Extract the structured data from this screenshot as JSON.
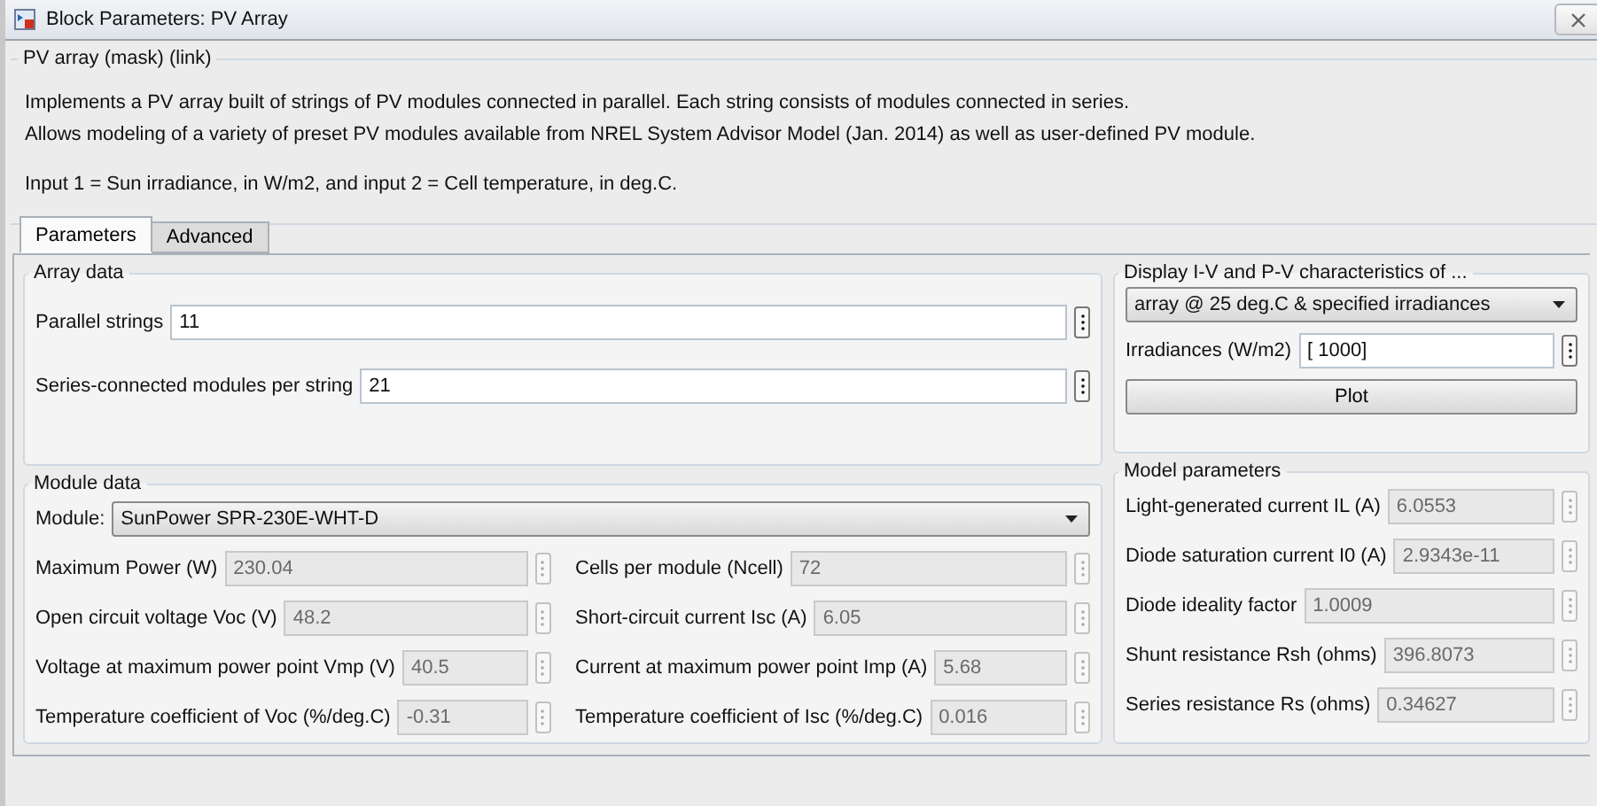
{
  "window": {
    "title": "Block Parameters: PV Array"
  },
  "mask": {
    "title": "PV array (mask) (link)",
    "description": [
      "Implements a PV array built of strings of PV modules connected in parallel. Each string consists of modules connected in series.",
      "Allows modeling of a variety of preset PV modules available from NREL System Advisor Model (Jan. 2014) as well as user-defined PV module."
    ],
    "inputs": "Input 1 = Sun irradiance, in W/m2, and input 2 = Cell temperature, in deg.C."
  },
  "tabs": [
    {
      "label": "Parameters",
      "selected": true
    },
    {
      "label": "Advanced",
      "selected": false
    }
  ],
  "array_data": {
    "title": "Array data",
    "fields": [
      {
        "label": "Parallel strings",
        "value": "11",
        "disabled": false
      },
      {
        "label": "Series-connected modules per string",
        "value": "21",
        "disabled": false
      }
    ]
  },
  "module_data": {
    "title": "Module data",
    "module_label": "Module:",
    "module": "SunPower SPR-230E-WHT-D",
    "fields": [
      {
        "label": "Maximum Power (W)",
        "value": "230.04",
        "disabled": true
      },
      {
        "label": "Cells per module (Ncell)",
        "value": "72",
        "disabled": true
      },
      {
        "label": "Open circuit voltage  Voc (V)",
        "value": "48.2",
        "disabled": true
      },
      {
        "label": "Short-circuit current Isc (A)",
        "value": "6.05",
        "disabled": true
      },
      {
        "label": "Voltage at maximum power point Vmp (V)",
        "value": "40.5",
        "disabled": true
      },
      {
        "label": "Current at maximum power point Imp (A)",
        "value": "5.68",
        "disabled": true
      },
      {
        "label": "Temperature coefficient of Voc (%/deg.C)",
        "value": "-0.31",
        "disabled": true
      },
      {
        "label": "Temperature coefficient of Isc (%/deg.C)",
        "value": "0.016",
        "disabled": true
      }
    ]
  },
  "display": {
    "title": "Display  I-V and P-V characteristics of ...",
    "selection": "array @ 25 deg.C & specified irradiances",
    "field": {
      "label": "Irradiances (W/m2)",
      "value": "[ 1000]",
      "disabled": false
    },
    "button": "Plot"
  },
  "model_parameters": {
    "title": "Model parameters",
    "fields": [
      {
        "label": "Light-generated current IL (A)",
        "value": "6.0553",
        "disabled": true
      },
      {
        "label": "Diode saturation current I0 (A)",
        "value": "2.9343e-11",
        "disabled": true
      },
      {
        "label": "Diode ideality factor",
        "value": "1.0009",
        "disabled": true
      },
      {
        "label": "Shunt resistance Rsh (ohms)",
        "value": "396.8073",
        "disabled": true
      },
      {
        "label": "Series resistance Rs (ohms)",
        "value": "0.34627",
        "disabled": true
      }
    ]
  }
}
